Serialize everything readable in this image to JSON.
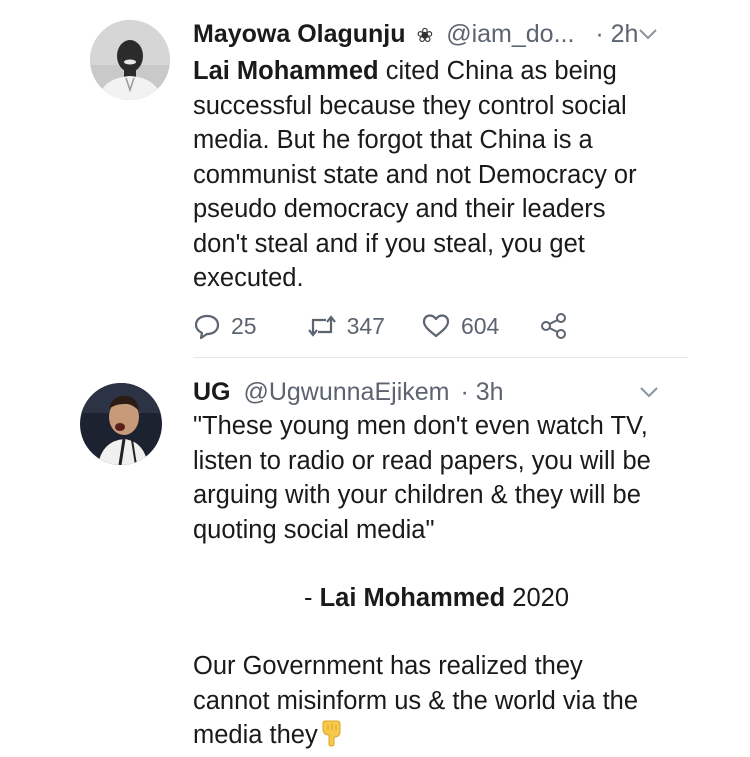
{
  "tweets": [
    {
      "name": "Mayowa Olagunju",
      "badge_icon": "flower-icon",
      "handle": "@iam_do...",
      "time": "· 2h",
      "body_bold": "Lai Mohammed",
      "body_rest_1": " cited China as being",
      "lines": [
        "successful because they control social",
        "media. But he forgot that China is a",
        "communist state and not Democracy or",
        "pseudo democracy and their leaders",
        "don't steal and if you steal, you get",
        "executed."
      ],
      "replies": "25",
      "retweets": "347",
      "likes": "604"
    },
    {
      "name": "UG",
      "handle": "@UgwunnaEjikem",
      "time": "· 3h",
      "quote_lines": [
        "\"These young men don't even watch TV,",
        "listen to radio or read papers, you will be",
        "arguing with your children & they will be",
        "quoting social media\""
      ],
      "signature_prefix": "- ",
      "signature_bold": "Lai Mohammed",
      "signature_year": " 2020",
      "tail_lines": [
        "Our Government has realized they",
        "cannot misinform us & the world via the",
        "media they"
      ],
      "emoji_icon": "pointing-down-hand-icon"
    }
  ],
  "colors": {
    "text": "#1a1a1a",
    "muted": "#5b6470",
    "divider": "#e3e6ea"
  }
}
